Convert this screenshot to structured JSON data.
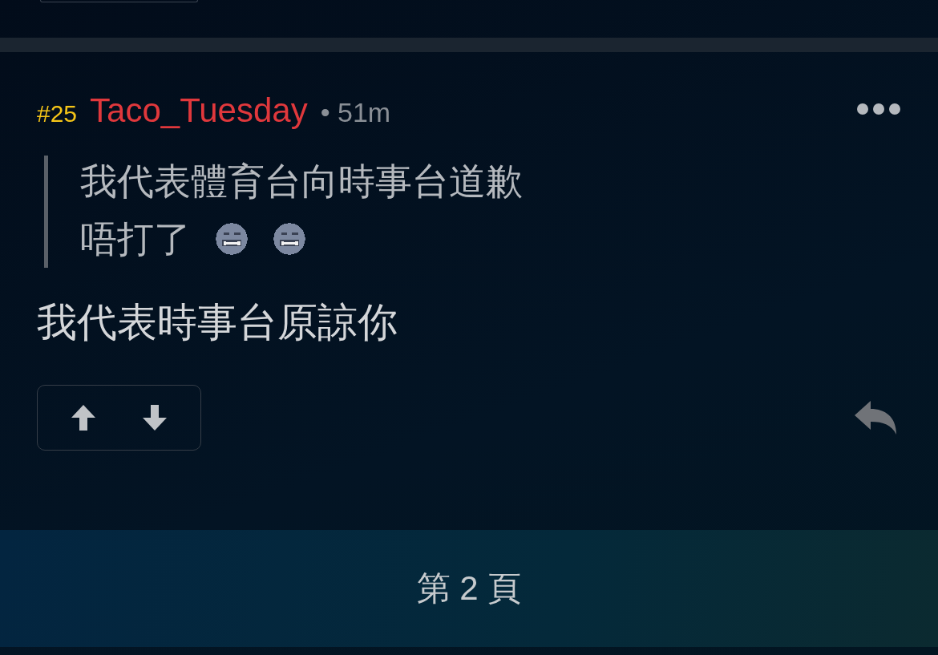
{
  "post": {
    "number": "#25",
    "username": "Taco_Tuesday",
    "time": "• 51m",
    "quote": [
      {
        "parts": [
          {
            "kind": "text",
            "text": "我代表體育台向時事台道歉"
          }
        ]
      },
      {
        "parts": [
          {
            "kind": "text",
            "text": "唔打了"
          },
          {
            "kind": "emoji"
          },
          {
            "kind": "emoji"
          }
        ]
      }
    ],
    "body": "我代表時事台原諒你"
  },
  "pager": {
    "label": "第 2 頁"
  }
}
